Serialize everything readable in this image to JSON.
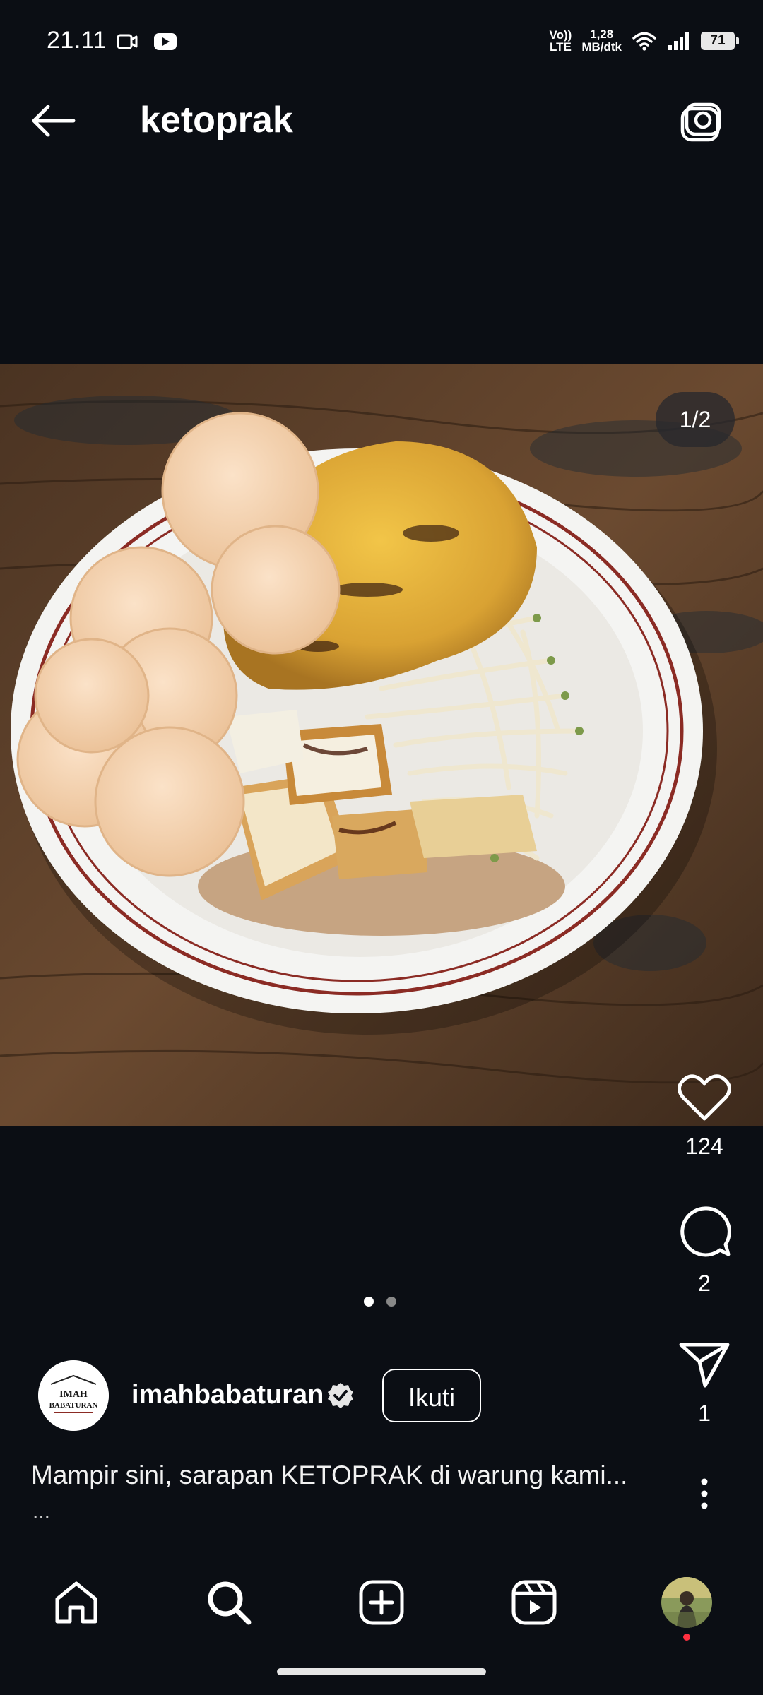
{
  "status_bar": {
    "time": "21.11",
    "left_icons": [
      "video-camera-icon",
      "youtube-icon"
    ],
    "network_type_top": "Vo))",
    "network_type_bottom": "LTE",
    "speed_top": "1,28",
    "speed_bottom": "MB/dtk",
    "battery": "71",
    "right_icons": [
      "wifi-icon",
      "signal-icon",
      "battery-icon"
    ]
  },
  "header": {
    "title": "ketoprak",
    "back_icon": "arrow-left-icon",
    "camera_icon": "camera-icon"
  },
  "post": {
    "image_counter": "1/2",
    "image_alt": "ketoprak-photo",
    "likes": "124",
    "comments": "2",
    "shares": "1",
    "carousel_pages": 2,
    "carousel_active": 1,
    "author": {
      "username": "imahbabaturan",
      "avatar_text": [
        "IMAH",
        "BABATURAN"
      ],
      "verified": true
    },
    "follow_label": "Ikuti",
    "caption": "Mampir sini, sarapan KETOPRAK di warung kami...",
    "caption_more": "..."
  },
  "bottom_nav": {
    "items": [
      "home-icon",
      "search-icon",
      "create-icon",
      "reels-icon",
      "profile-avatar"
    ]
  },
  "colors": {
    "background": "#0b0e14",
    "text": "#ffffff",
    "notification": "#ff3040"
  }
}
